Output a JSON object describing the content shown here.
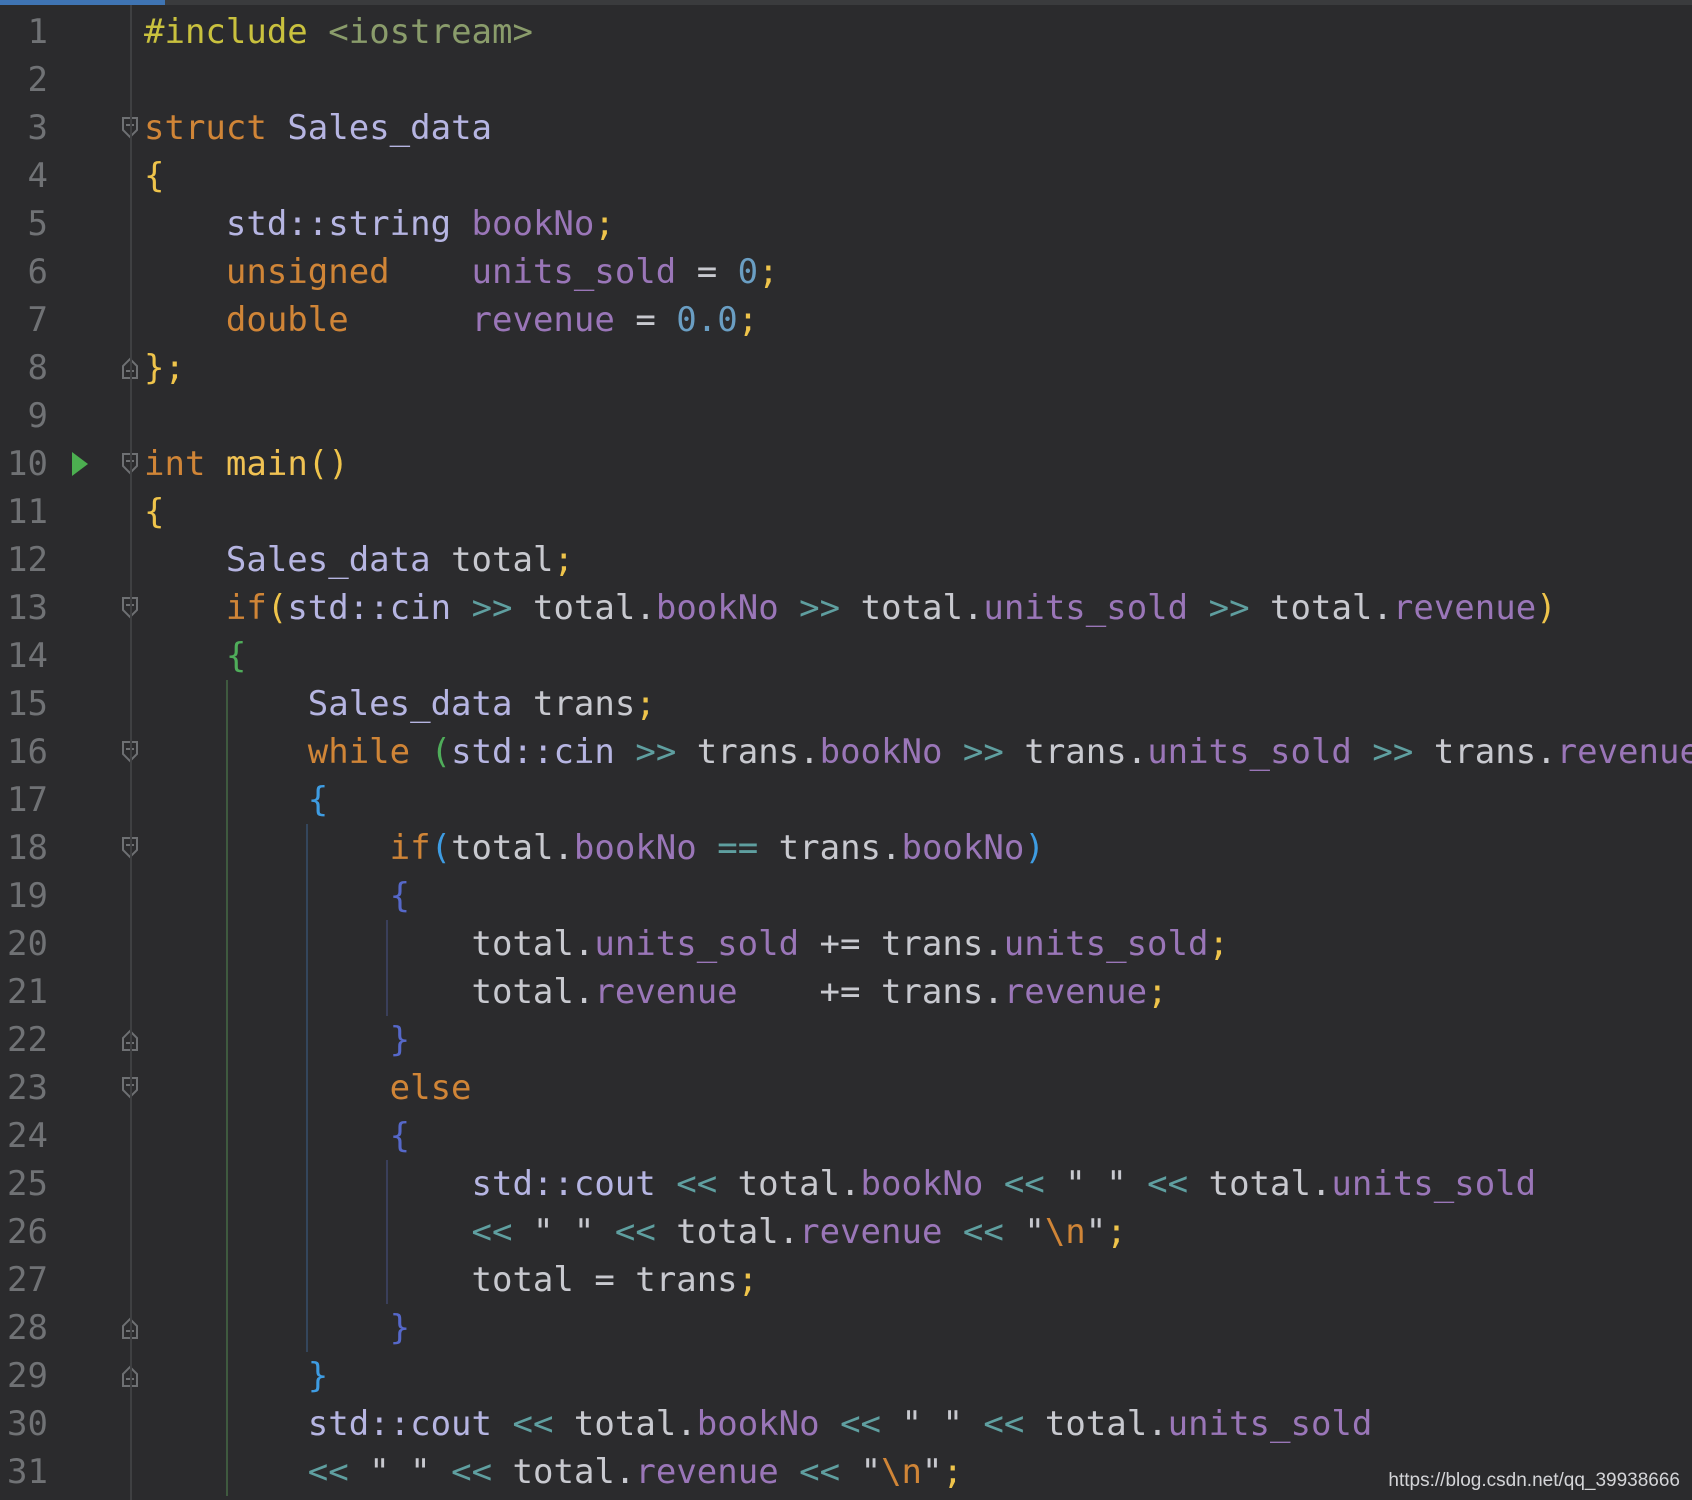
{
  "colors": {
    "background": "#2b2b2d",
    "line_number": "#707275",
    "keyword": "#d08537",
    "type_name": "#b6b5e2",
    "identifier": "#c8c9cf",
    "field": "#9a76b8",
    "number": "#6a9ec3",
    "function": "#f0c253",
    "operator": "#5f9fa0",
    "string": "#c8c9cf",
    "escape": "#d08537",
    "include": "#c9c13e",
    "header": "#8a9c6b",
    "brace_level1": "#efc44b",
    "brace_level2": "#4fad5a",
    "brace_level3": "#3e9ce2",
    "brace_level4": "#5668c9",
    "run_icon": "#4caf50",
    "active_tab": "#3f74b3"
  },
  "editor": {
    "lines": [
      {
        "n": "1",
        "tokens": [
          [
            "#include",
            "include"
          ],
          [
            " ",
            "plain"
          ],
          [
            "<iostream>",
            "header"
          ]
        ]
      },
      {
        "n": "2",
        "tokens": []
      },
      {
        "n": "3",
        "tokens": [
          [
            "struct",
            "keyword"
          ],
          [
            " ",
            "plain"
          ],
          [
            "Sales_data",
            "type"
          ]
        ]
      },
      {
        "n": "4",
        "tokens": [
          [
            "{",
            "b1"
          ]
        ]
      },
      {
        "n": "5",
        "tokens": [
          [
            "    ",
            "plain"
          ],
          [
            "std::string",
            "type"
          ],
          [
            " ",
            "plain"
          ],
          [
            "bookNo",
            "field"
          ],
          [
            ";",
            "b1"
          ]
        ]
      },
      {
        "n": "6",
        "tokens": [
          [
            "    ",
            "plain"
          ],
          [
            "unsigned",
            "keyword"
          ],
          [
            "    ",
            "plain"
          ],
          [
            "units_sold",
            "field"
          ],
          [
            " = ",
            "ident"
          ],
          [
            "0",
            "number"
          ],
          [
            ";",
            "b1"
          ]
        ]
      },
      {
        "n": "7",
        "tokens": [
          [
            "    ",
            "plain"
          ],
          [
            "double",
            "keyword"
          ],
          [
            "      ",
            "plain"
          ],
          [
            "revenue",
            "field"
          ],
          [
            " = ",
            "ident"
          ],
          [
            "0.0",
            "number"
          ],
          [
            ";",
            "b1"
          ]
        ]
      },
      {
        "n": "8",
        "tokens": [
          [
            "};",
            "b1"
          ]
        ]
      },
      {
        "n": "9",
        "tokens": []
      },
      {
        "n": "10",
        "tokens": [
          [
            "int",
            "keyword"
          ],
          [
            " ",
            "plain"
          ],
          [
            "main",
            "function"
          ],
          [
            "()",
            "b1"
          ]
        ]
      },
      {
        "n": "11",
        "tokens": [
          [
            "{",
            "b1"
          ]
        ]
      },
      {
        "n": "12",
        "tokens": [
          [
            "    ",
            "plain"
          ],
          [
            "Sales_data",
            "type"
          ],
          [
            " ",
            "plain"
          ],
          [
            "total",
            "ident"
          ],
          [
            ";",
            "b1"
          ]
        ]
      },
      {
        "n": "13",
        "tokens": [
          [
            "    ",
            "plain"
          ],
          [
            "if",
            "keyword"
          ],
          [
            "(",
            "b1"
          ],
          [
            "std::cin",
            "type"
          ],
          [
            " ",
            "plain"
          ],
          [
            ">>",
            "operator"
          ],
          [
            " ",
            "plain"
          ],
          [
            "total.",
            "ident"
          ],
          [
            "bookNo",
            "field"
          ],
          [
            " ",
            "plain"
          ],
          [
            ">>",
            "operator"
          ],
          [
            " ",
            "plain"
          ],
          [
            "total.",
            "ident"
          ],
          [
            "units_sold",
            "field"
          ],
          [
            " ",
            "plain"
          ],
          [
            ">>",
            "operator"
          ],
          [
            " ",
            "plain"
          ],
          [
            "total.",
            "ident"
          ],
          [
            "revenue",
            "field"
          ],
          [
            ")",
            "b1"
          ]
        ]
      },
      {
        "n": "14",
        "tokens": [
          [
            "    ",
            "plain"
          ],
          [
            "{",
            "b2"
          ]
        ]
      },
      {
        "n": "15",
        "tokens": [
          [
            "        ",
            "plain"
          ],
          [
            "Sales_data",
            "type"
          ],
          [
            " ",
            "plain"
          ],
          [
            "trans",
            "ident"
          ],
          [
            ";",
            "b1"
          ]
        ]
      },
      {
        "n": "16",
        "tokens": [
          [
            "        ",
            "plain"
          ],
          [
            "while",
            "keyword"
          ],
          [
            " ",
            "plain"
          ],
          [
            "(",
            "b2"
          ],
          [
            "std::cin",
            "type"
          ],
          [
            " ",
            "plain"
          ],
          [
            ">>",
            "operator"
          ],
          [
            " ",
            "plain"
          ],
          [
            "trans.",
            "ident"
          ],
          [
            "bookNo",
            "field"
          ],
          [
            " ",
            "plain"
          ],
          [
            ">>",
            "operator"
          ],
          [
            " ",
            "plain"
          ],
          [
            "trans.",
            "ident"
          ],
          [
            "units_sold",
            "field"
          ],
          [
            " ",
            "plain"
          ],
          [
            ">>",
            "operator"
          ],
          [
            " ",
            "plain"
          ],
          [
            "trans.",
            "ident"
          ],
          [
            "revenue",
            "field"
          ],
          [
            ")",
            "b2"
          ]
        ]
      },
      {
        "n": "17",
        "tokens": [
          [
            "        ",
            "plain"
          ],
          [
            "{",
            "b3"
          ]
        ]
      },
      {
        "n": "18",
        "tokens": [
          [
            "            ",
            "plain"
          ],
          [
            "if",
            "keyword"
          ],
          [
            "(",
            "b3"
          ],
          [
            "total.",
            "ident"
          ],
          [
            "bookNo",
            "field"
          ],
          [
            " ",
            "plain"
          ],
          [
            "==",
            "operator"
          ],
          [
            " ",
            "plain"
          ],
          [
            "trans.",
            "ident"
          ],
          [
            "bookNo",
            "field"
          ],
          [
            ")",
            "b3"
          ]
        ]
      },
      {
        "n": "19",
        "tokens": [
          [
            "            ",
            "plain"
          ],
          [
            "{",
            "b4"
          ]
        ]
      },
      {
        "n": "20",
        "tokens": [
          [
            "                ",
            "plain"
          ],
          [
            "total.",
            "ident"
          ],
          [
            "units_sold",
            "field"
          ],
          [
            " += ",
            "ident"
          ],
          [
            "trans.",
            "ident"
          ],
          [
            "units_sold",
            "field"
          ],
          [
            ";",
            "b1"
          ]
        ]
      },
      {
        "n": "21",
        "tokens": [
          [
            "                ",
            "plain"
          ],
          [
            "total.",
            "ident"
          ],
          [
            "revenue",
            "field"
          ],
          [
            "    += ",
            "ident"
          ],
          [
            "trans.",
            "ident"
          ],
          [
            "revenue",
            "field"
          ],
          [
            ";",
            "b1"
          ]
        ]
      },
      {
        "n": "22",
        "tokens": [
          [
            "            ",
            "plain"
          ],
          [
            "}",
            "b4"
          ]
        ]
      },
      {
        "n": "23",
        "tokens": [
          [
            "            ",
            "plain"
          ],
          [
            "else",
            "keyword"
          ]
        ]
      },
      {
        "n": "24",
        "tokens": [
          [
            "            ",
            "plain"
          ],
          [
            "{",
            "b4"
          ]
        ]
      },
      {
        "n": "25",
        "tokens": [
          [
            "                ",
            "plain"
          ],
          [
            "std::cout",
            "type"
          ],
          [
            " ",
            "plain"
          ],
          [
            "<<",
            "operator"
          ],
          [
            " ",
            "plain"
          ],
          [
            "total.",
            "ident"
          ],
          [
            "bookNo",
            "field"
          ],
          [
            " ",
            "plain"
          ],
          [
            "<<",
            "operator"
          ],
          [
            " ",
            "plain"
          ],
          [
            "\" \"",
            "string"
          ],
          [
            " ",
            "plain"
          ],
          [
            "<<",
            "operator"
          ],
          [
            " ",
            "plain"
          ],
          [
            "total.",
            "ident"
          ],
          [
            "units_sold",
            "field"
          ]
        ]
      },
      {
        "n": "26",
        "tokens": [
          [
            "                ",
            "plain"
          ],
          [
            "<<",
            "operator"
          ],
          [
            " ",
            "plain"
          ],
          [
            "\" \"",
            "string"
          ],
          [
            " ",
            "plain"
          ],
          [
            "<<",
            "operator"
          ],
          [
            " ",
            "plain"
          ],
          [
            "total.",
            "ident"
          ],
          [
            "revenue",
            "field"
          ],
          [
            " ",
            "plain"
          ],
          [
            "<<",
            "operator"
          ],
          [
            " ",
            "plain"
          ],
          [
            "\"",
            "string"
          ],
          [
            "\\n",
            "escape"
          ],
          [
            "\"",
            "string"
          ],
          [
            ";",
            "b1"
          ]
        ]
      },
      {
        "n": "27",
        "tokens": [
          [
            "                ",
            "plain"
          ],
          [
            "total",
            "ident"
          ],
          [
            " = ",
            "ident"
          ],
          [
            "trans",
            "ident"
          ],
          [
            ";",
            "b1"
          ]
        ]
      },
      {
        "n": "28",
        "tokens": [
          [
            "            ",
            "plain"
          ],
          [
            "}",
            "b4"
          ]
        ]
      },
      {
        "n": "29",
        "tokens": [
          [
            "        ",
            "plain"
          ],
          [
            "}",
            "b3"
          ]
        ]
      },
      {
        "n": "30",
        "tokens": [
          [
            "        ",
            "plain"
          ],
          [
            "std::cout",
            "type"
          ],
          [
            " ",
            "plain"
          ],
          [
            "<<",
            "operator"
          ],
          [
            " ",
            "plain"
          ],
          [
            "total.",
            "ident"
          ],
          [
            "bookNo",
            "field"
          ],
          [
            " ",
            "plain"
          ],
          [
            "<<",
            "operator"
          ],
          [
            " ",
            "plain"
          ],
          [
            "\" \"",
            "string"
          ],
          [
            " ",
            "plain"
          ],
          [
            "<<",
            "operator"
          ],
          [
            " ",
            "plain"
          ],
          [
            "total.",
            "ident"
          ],
          [
            "units_sold",
            "field"
          ]
        ]
      },
      {
        "n": "31",
        "tokens": [
          [
            "        ",
            "plain"
          ],
          [
            "<<",
            "operator"
          ],
          [
            " ",
            "plain"
          ],
          [
            "\" \"",
            "string"
          ],
          [
            " ",
            "plain"
          ],
          [
            "<<",
            "operator"
          ],
          [
            " ",
            "plain"
          ],
          [
            "total.",
            "ident"
          ],
          [
            "revenue",
            "field"
          ],
          [
            " ",
            "plain"
          ],
          [
            "<<",
            "operator"
          ],
          [
            " ",
            "plain"
          ],
          [
            "\"",
            "string"
          ],
          [
            "\\n",
            "escape"
          ],
          [
            "\"",
            "string"
          ],
          [
            ";",
            "b1"
          ]
        ]
      }
    ],
    "fold_open_lines": [
      "3",
      "10",
      "13",
      "16",
      "18",
      "23"
    ],
    "fold_close_lines": [
      "8",
      "22",
      "28",
      "29"
    ],
    "run_line": "10"
  },
  "watermark": "https://blog.csdn.net/qq_39938666"
}
